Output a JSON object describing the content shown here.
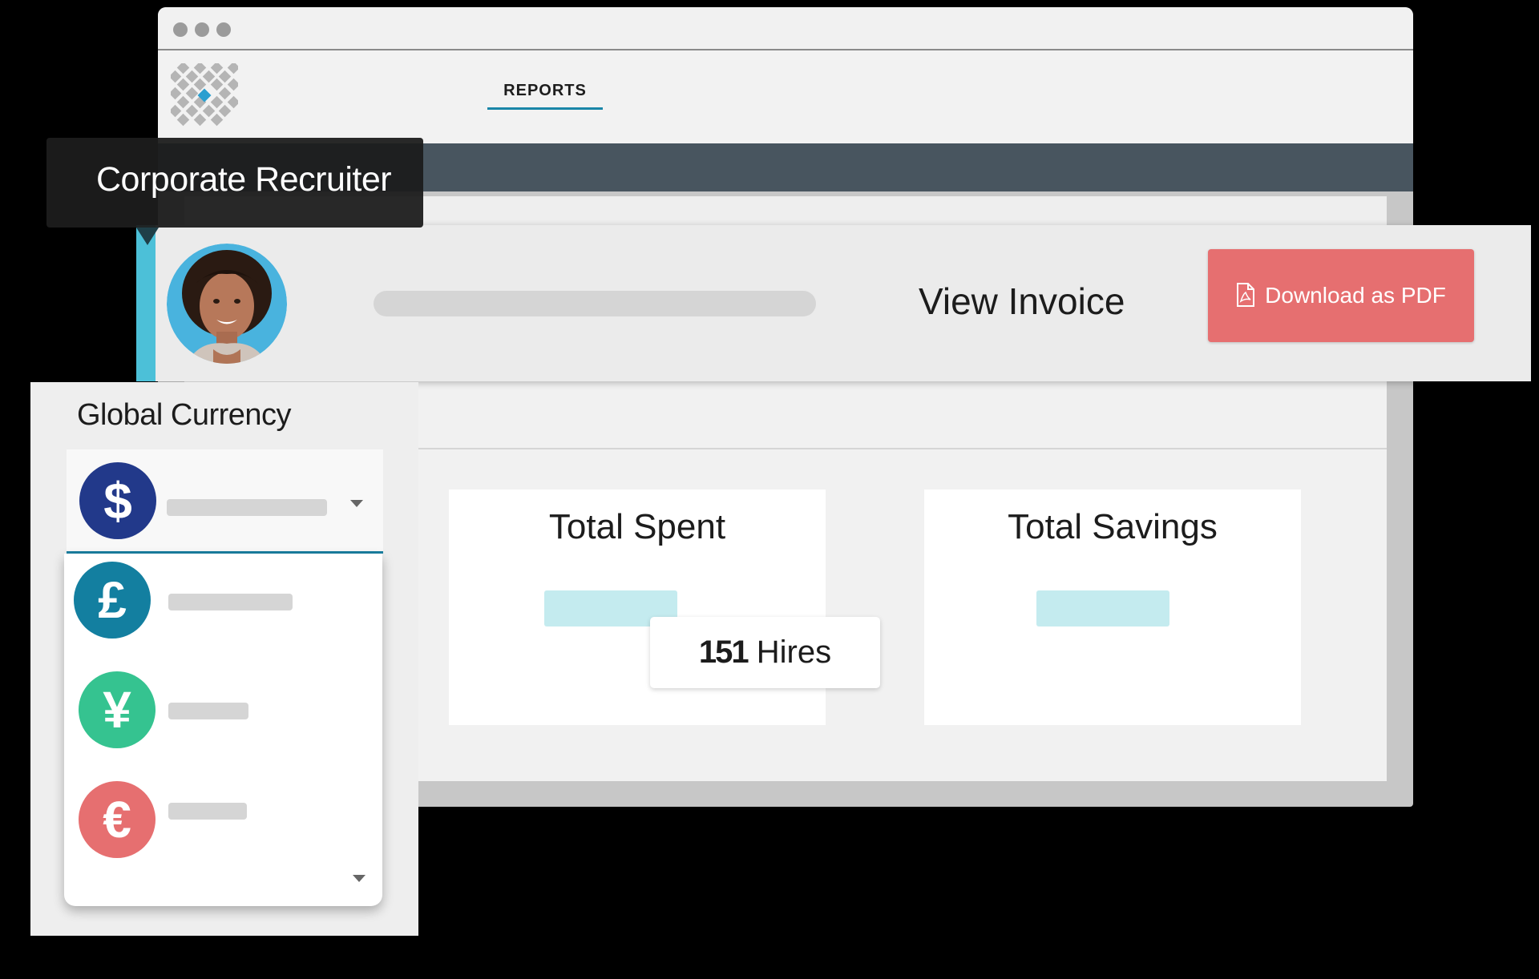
{
  "header": {
    "tabs": [
      {
        "label": "REPORTS",
        "active": true
      }
    ]
  },
  "tooltip": {
    "title": "Corporate Recruiter"
  },
  "invoice": {
    "view_label": "View Invoice",
    "download_label": "Download as PDF",
    "download_color": "#e66f70",
    "accent_color": "#4cc0d8"
  },
  "stats": {
    "total_spent_label": "Total Spent",
    "total_savings_label": "Total Savings",
    "hires_count": "151",
    "hires_label": "Hires"
  },
  "currency": {
    "title": "Global Currency",
    "selected": {
      "symbol": "$",
      "color": "#22398a",
      "icon": "dollar-icon"
    },
    "options": [
      {
        "symbol": "£",
        "color": "#137fa0",
        "icon": "pound-icon"
      },
      {
        "symbol": "¥",
        "color": "#35c390",
        "icon": "yen-icon"
      },
      {
        "symbol": "€",
        "color": "#e66f70",
        "icon": "euro-icon"
      }
    ]
  }
}
